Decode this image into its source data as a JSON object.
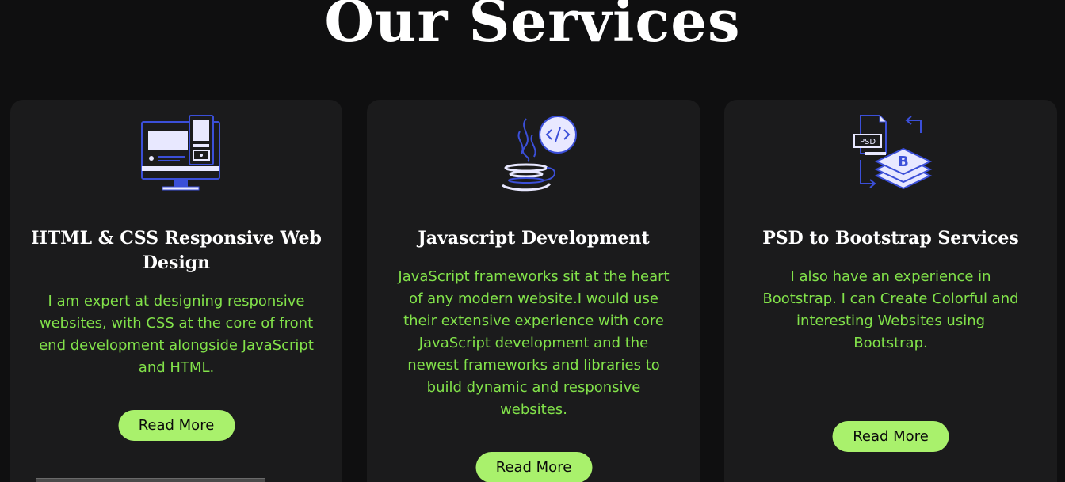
{
  "section": {
    "title": "Our Services"
  },
  "cards": [
    {
      "icon": "desktop-monitor-icon",
      "title": "HTML & CSS Responsive Web Design",
      "description": "I am expert at designing responsive websites, with CSS at the core of front end development alongside JavaScript and HTML.",
      "button_label": "Read More"
    },
    {
      "icon": "java-code-icon",
      "title": "Javascript Development",
      "description": "JavaScript frameworks sit at the heart of any modern website.I would use their extensive experience with core JavaScript development and the newest frameworks and libraries to build dynamic and responsive websites.",
      "button_label": "Read More"
    },
    {
      "icon": "psd-to-bootstrap-icon",
      "title": "PSD to Bootstrap Services",
      "description": "I also have an experience in Bootstrap. I can Create Colorful and interesting Websites using Bootstrap.",
      "button_label": "Read More"
    }
  ],
  "colors": {
    "background": "#0f0f10",
    "card": "#1b1b1c",
    "accent_text": "#82e24a",
    "button": "#a9f16c",
    "icon_stroke": "#3b4fd8",
    "icon_fill": "#e8e8ff"
  }
}
